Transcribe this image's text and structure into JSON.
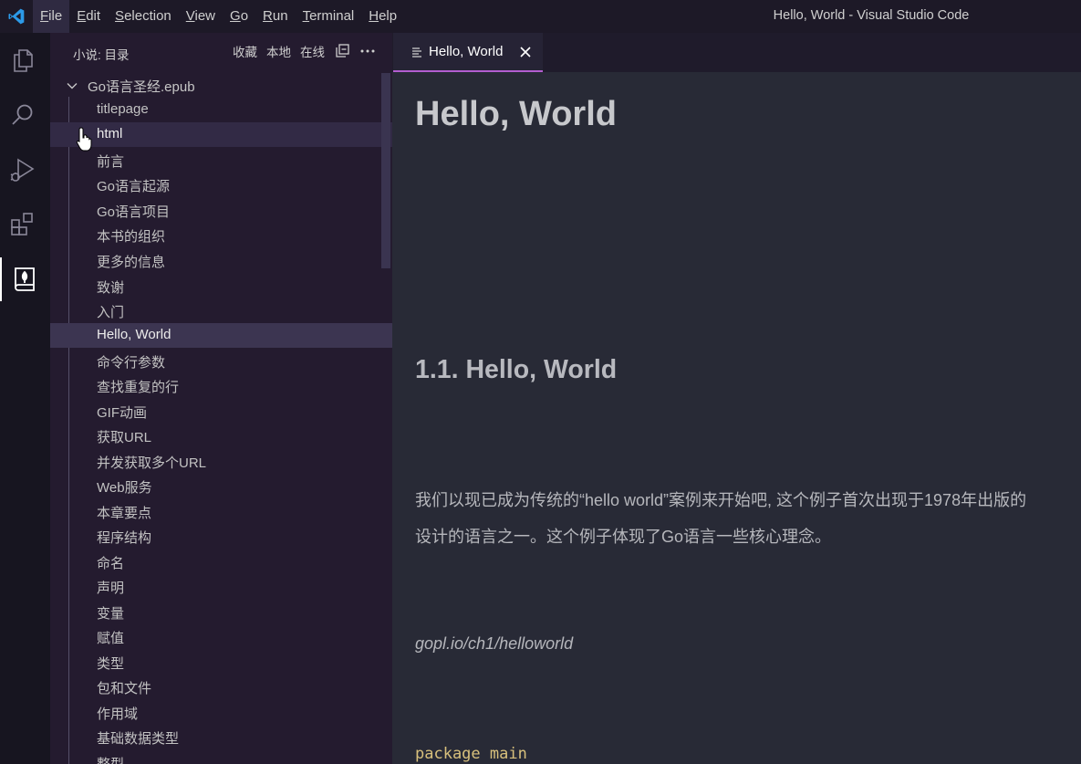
{
  "window": {
    "title": "Hello, World - Visual Studio Code"
  },
  "menu": [
    {
      "label": "File",
      "active": true
    },
    {
      "label": "Edit"
    },
    {
      "label": "Selection"
    },
    {
      "label": "View"
    },
    {
      "label": "Go"
    },
    {
      "label": "Run"
    },
    {
      "label": "Terminal"
    },
    {
      "label": "Help"
    }
  ],
  "activity_bar": {
    "icons": [
      "files-icon",
      "search-icon",
      "run-debug-icon",
      "extensions-icon",
      "book-reader-icon"
    ],
    "active": "book-reader-icon"
  },
  "sidebar": {
    "title": "小说: 目录",
    "actions": {
      "favorites": "收藏",
      "local": "本地",
      "online": "在线"
    },
    "root": "Go语言圣经.epub",
    "items": [
      "titlepage",
      "html",
      "前言",
      "Go语言起源",
      "Go语言项目",
      "本书的组织",
      "更多的信息",
      "致谢",
      "入门",
      "Hello, World",
      "命令行参数",
      "查找重复的行",
      "GIF动画",
      "获取URL",
      "并发获取多个URL",
      "Web服务",
      "本章要点",
      "程序结构",
      "命名",
      "声明",
      "变量",
      "赋值",
      "类型",
      "包和文件",
      "作用域",
      "基础数据类型",
      "整型"
    ],
    "hovered_item": "html",
    "selected_item": "Hello, World"
  },
  "tab": {
    "label": "Hello, World"
  },
  "editor": {
    "heading1": "Hello, World",
    "heading2": "1.1. Hello, World",
    "para_line1": "我们以现已成为传统的“hello world”案例来开始吧, 这个例子首次出现于1978年出版的",
    "para_line2": "设计的语言之一。这个例子体现了Go语言一些核心理念。",
    "source_ref": "gopl.io/ch1/helloworld",
    "code_line1": "package main"
  },
  "colors": {
    "accent": "#b35ed0",
    "code": "#d8c07c",
    "vscode_blue": "#2c9ae8"
  }
}
